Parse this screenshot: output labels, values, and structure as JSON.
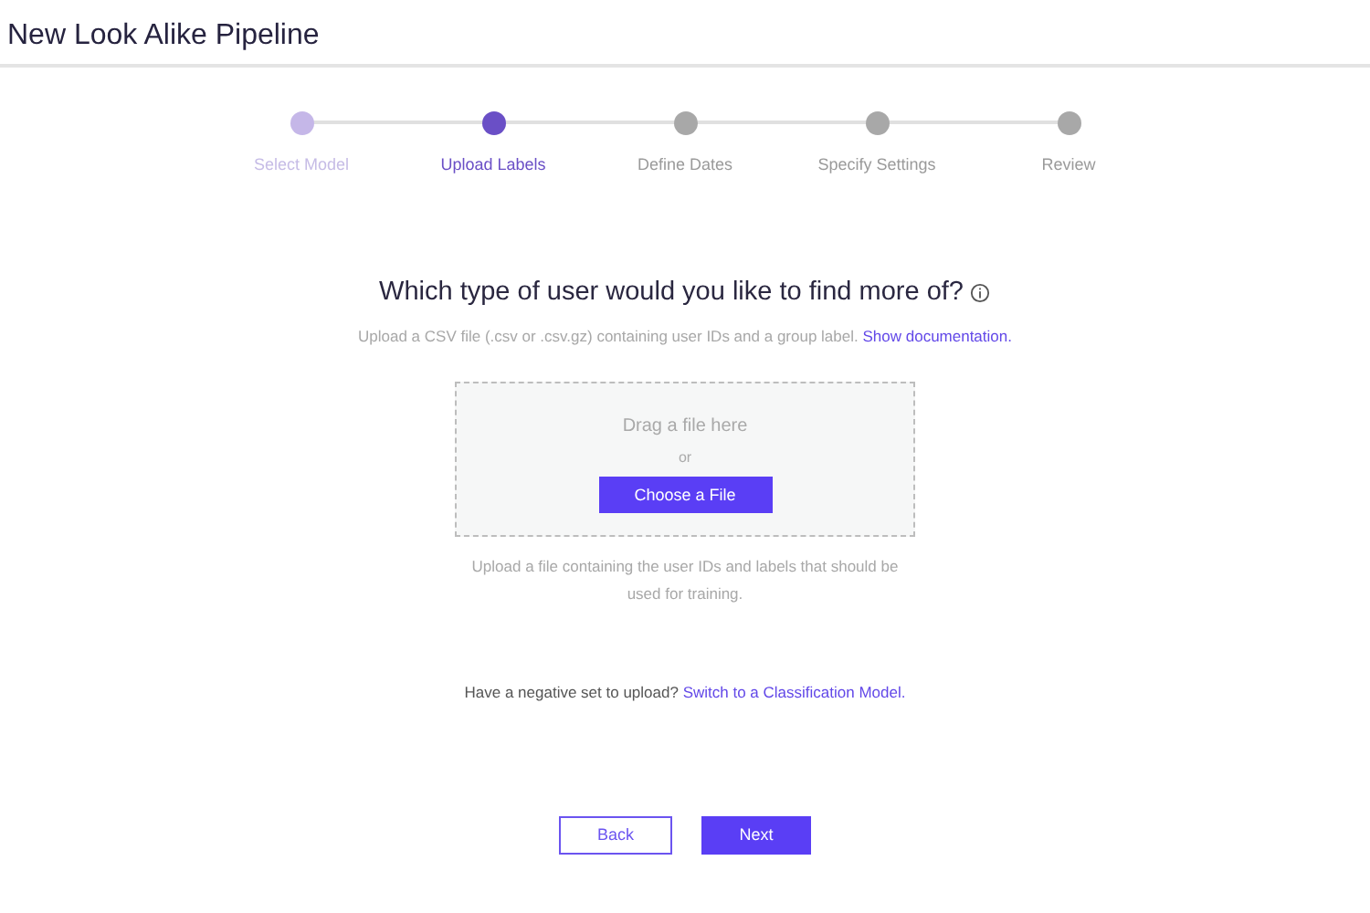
{
  "page_title": "New Look Alike Pipeline",
  "steps": [
    {
      "label": "Select Model",
      "completed": true,
      "selected": false
    },
    {
      "label": "Upload Labels",
      "completed": false,
      "selected": true
    },
    {
      "label": "Define Dates",
      "completed": false,
      "selected": false
    },
    {
      "label": "Specify Settings",
      "completed": false,
      "selected": false
    },
    {
      "label": "Review",
      "completed": false,
      "selected": false
    }
  ],
  "heading": "Which type of user would you like to find more of?",
  "description": {
    "text": "Upload a CSV file (.csv or .csv.gz) containing user IDs and a group label.",
    "link": "Show documentation."
  },
  "dropzone": {
    "prompt": "Drag a file here",
    "separator": "or",
    "button": "Choose a File"
  },
  "upload_hint": "Upload a file containing the user IDs and labels that should be used for training.",
  "negative": {
    "text": "Have a negative set to upload?",
    "link": "Switch to a Classification Model."
  },
  "buttons": {
    "back": "Back",
    "next": "Next"
  }
}
